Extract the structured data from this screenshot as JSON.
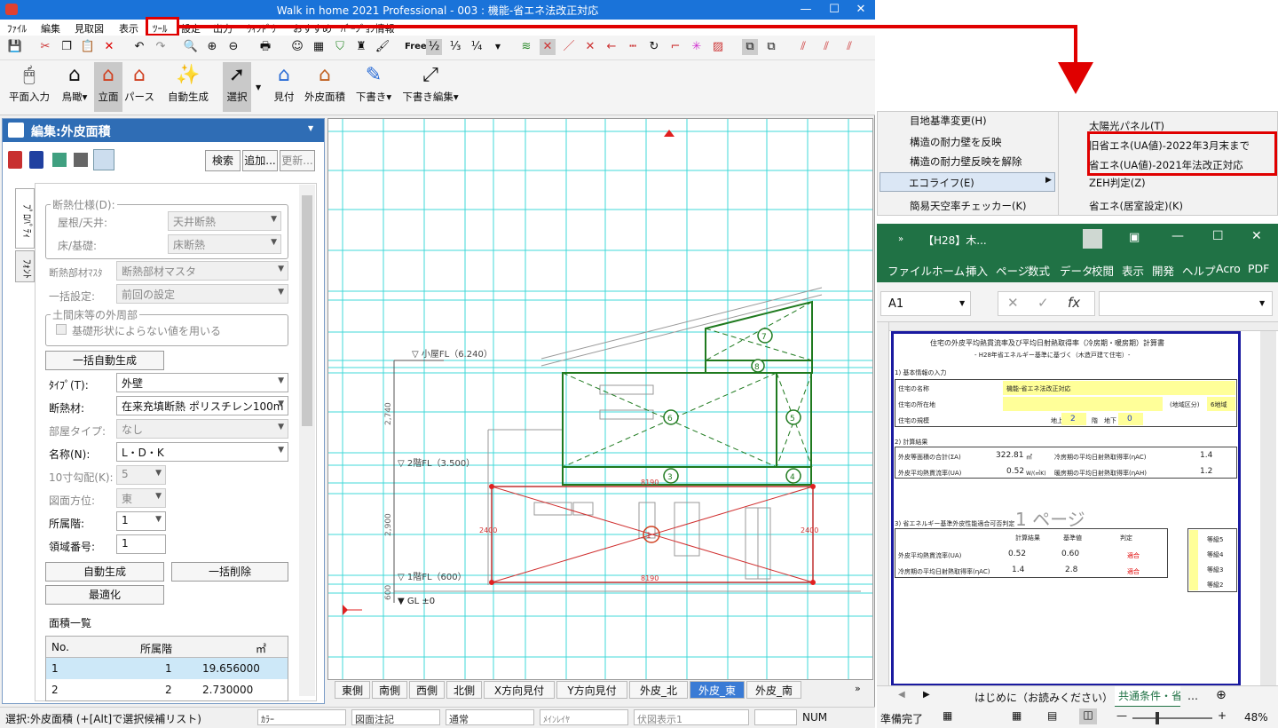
{
  "app": {
    "title": "Walk in home 2021 Professional - 003 : 機能-省エネ法改正対応",
    "menu": [
      "ﾌｧｲﾙ",
      "編集",
      "見取図",
      "表示",
      "ﾂｰﾙ",
      "設定",
      "出力",
      "ｳｨﾝﾄﾞｳ",
      "おすすめ",
      "ﾊﾞｰｼﾞｮﾝ情報"
    ],
    "ribbon": [
      "平面入力",
      "鳥瞰▾",
      "立面",
      "パース",
      "自動生成",
      "選択",
      "見付",
      "外皮面積",
      "下書き▾",
      "下書き編集▾"
    ],
    "toolbar_text": {
      "free": "Free",
      "half": "½",
      "third": "⅓",
      "quarter": "¼"
    }
  },
  "panel": {
    "title": "編集:外皮面積",
    "buttons": {
      "search": "検索",
      "add": "追加...",
      "update": "更新..."
    },
    "side_tabs": [
      "ﾌﾟﾛﾊﾟﾃｨ",
      "ﾌｫﾝﾄ"
    ],
    "insulation_group": "断熱仕様(D):",
    "roof_label": "屋根/天井:",
    "roof_value": "天井断熱",
    "floor_label": "床/基礎:",
    "floor_value": "床断熱",
    "master_label": "断熱部材ﾏｽﾀ",
    "master_value": "断熱部材マスタ",
    "bulk_label": "一括設定:",
    "bulk_value": "前回の設定",
    "earth_group": "土間床等の外周部",
    "earth_check": "基礎形状によらない値を用いる",
    "bulk_auto": "一括自動生成",
    "type_label": "ﾀｲﾌﾟ(T):",
    "type_value": "外壁",
    "ins_label": "断熱材:",
    "ins_value": "在来充填断熱  ポリスチレン100m",
    "room_label": "部屋タイプ:",
    "room_value": "なし",
    "name_label": "名称(N):",
    "name_value": "L・D・K",
    "slope_label": "10寸勾配(K):",
    "slope_value": "5",
    "dir_label": "図面方位:",
    "dir_value": "東",
    "floorlv_label": "所属階:",
    "floorlv_value": "1",
    "region_label": "領域番号:",
    "region_value": "1",
    "auto_btn": "自動生成",
    "bulkdel_btn": "一括削除",
    "opt_btn": "最適化",
    "list_title": "面積一覧",
    "table": {
      "headers": [
        "No.",
        "所属階",
        "㎡"
      ],
      "rows": [
        [
          "1",
          "1",
          "19.656000"
        ],
        [
          "2",
          "2",
          "2.730000"
        ]
      ]
    }
  },
  "drawing": {
    "labels": {
      "attic": "▽ 小屋FL（6.240）",
      "f2": "▽ 2階FL（3.500）",
      "f1": "▽ 1階FL（600）",
      "gl": "▼ GL ±0"
    },
    "dims": [
      "2,740",
      "2,900",
      "600",
      "8190",
      "8190",
      "2400",
      "2400"
    ],
    "markers": [
      "7",
      "8",
      "6",
      "5",
      "4",
      "3",
      "1"
    ]
  },
  "view_tabs": [
    "東側",
    "南側",
    "西側",
    "北側",
    "X方向見付",
    "Y方向見付",
    "外皮_北",
    "外皮_東",
    "外皮_南"
  ],
  "status": {
    "msg": "選択:外皮面積 (+[Alt]で選択候補リスト)",
    "boxes": [
      "ｶﾗｰ",
      "図面注記",
      "通常",
      "ﾒｲﾝﾚｲﾔ",
      "伏図表示1"
    ],
    "num": "NUM"
  },
  "menu_shot": {
    "left": [
      "目地基準変更(H)",
      "構造の耐力壁を反映",
      "構造の耐力壁反映を解除",
      "エコライフ(E)",
      "簡易天空率チェッカー(K)"
    ],
    "right": [
      "太陽光パネル(T)",
      "旧省エネ(UA値)-2022年3月末まで",
      "省エネ(UA値)-2021年法改正対応",
      "ZEH判定(Z)",
      "省エネ(居室設定)(K)"
    ]
  },
  "excel": {
    "title": "【H28】木...",
    "ribbon": [
      "ファイル",
      "ホーム",
      "挿入",
      "ページ",
      "数式",
      "データ",
      "校閲",
      "表示",
      "開発",
      "ヘルプ",
      "Acro",
      "PDF"
    ],
    "namebox": "A1",
    "sheet_title": "住宅の外皮平均熱貫流率及び平均日射熱取得率（冷房期・暖房期）計算書",
    "sheet_sub": "- H28年省エネルギー基準に基づく（木造戸建て住宅）-",
    "sec1": "1) 基本情報の入力",
    "house_name_label": "住宅の名称",
    "house_name": "機能-省エネ法改正対応",
    "addr_label": "住宅の所在地",
    "zone_label": "(地域区分)",
    "zone": "6地域",
    "scale_label": "住宅の規模",
    "above": "地上",
    "above_n": "2",
    "floor_unit": "階",
    "below": "地下",
    "below_n": "0",
    "sec2": "2) 計算結果",
    "r1": "外皮等面積の合計(ΣA)",
    "r1v": "322.81",
    "r1u": "㎡",
    "r1b": "冷房期の平均日射熱取得率(ηAC)",
    "r1bv": "1.4",
    "r2": "外皮平均熱貫流率(UA)",
    "r2v": "0.52",
    "r2u": "W/(㎡K)",
    "r2b": "暖房期の平均日射熱取得率(ηAH)",
    "r2bv": "1.2",
    "sec3": "3) 省エネルギー基準外皮性能適合可否判定",
    "page_label": "1 ページ",
    "jhead": [
      "計算結果",
      "基準値",
      "判定"
    ],
    "j1": [
      "外皮平均熱貫流率(UA)",
      "0.52",
      "0.60",
      "適合"
    ],
    "j2": [
      "冷房期の平均日射熱取得率(ηAC)",
      "1.4",
      "2.8",
      "適合"
    ],
    "grades": [
      "等級5",
      "等級4",
      "等級3",
      "等級2"
    ],
    "sheet_tabs": [
      "はじめに（お読みください）",
      "共通条件・省"
    ],
    "status": "準備完了",
    "zoom": "48%"
  }
}
